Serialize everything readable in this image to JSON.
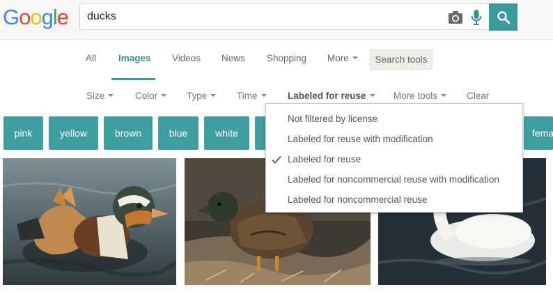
{
  "brand": {
    "logo_letters": [
      {
        "char": "G",
        "color": "#4285f4"
      },
      {
        "char": "o",
        "color": "#ea4335"
      },
      {
        "char": "o",
        "color": "#fbbc05"
      },
      {
        "char": "g",
        "color": "#4285f4"
      },
      {
        "char": "l",
        "color": "#34a853"
      },
      {
        "char": "e",
        "color": "#ea4335"
      }
    ]
  },
  "search": {
    "query": "ducks"
  },
  "icons": {
    "camera": "camera-icon",
    "mic": "mic-icon",
    "search": "search-icon",
    "check": "check-icon",
    "caret": "caret-down-icon"
  },
  "colors": {
    "accent": "#3b9a9b",
    "chip": "#3f9e9f"
  },
  "tabs": {
    "all": "All",
    "images": "Images",
    "videos": "Videos",
    "news": "News",
    "shopping": "Shopping",
    "more": "More",
    "search_tools": "Search tools",
    "active": "Images"
  },
  "filters": {
    "size": "Size",
    "color": "Color",
    "type": "Type",
    "time": "Time",
    "usage": "Labeled for reuse",
    "more_tools": "More tools",
    "clear": "Clear"
  },
  "chips": [
    "pink",
    "yellow",
    "brown",
    "blue",
    "white",
    "fema"
  ],
  "usage_dropdown": {
    "items": [
      "Not filtered by license",
      "Labeled for reuse with modification",
      "Labeled for reuse",
      "Labeled for noncommercial reuse with modification",
      "Labeled for noncommercial reuse"
    ],
    "selected": "Labeled for reuse"
  },
  "images": [
    {
      "subject": "mandarin duck swimming"
    },
    {
      "subject": "brown duck on shore"
    },
    {
      "subject": "white duck on water"
    }
  ]
}
